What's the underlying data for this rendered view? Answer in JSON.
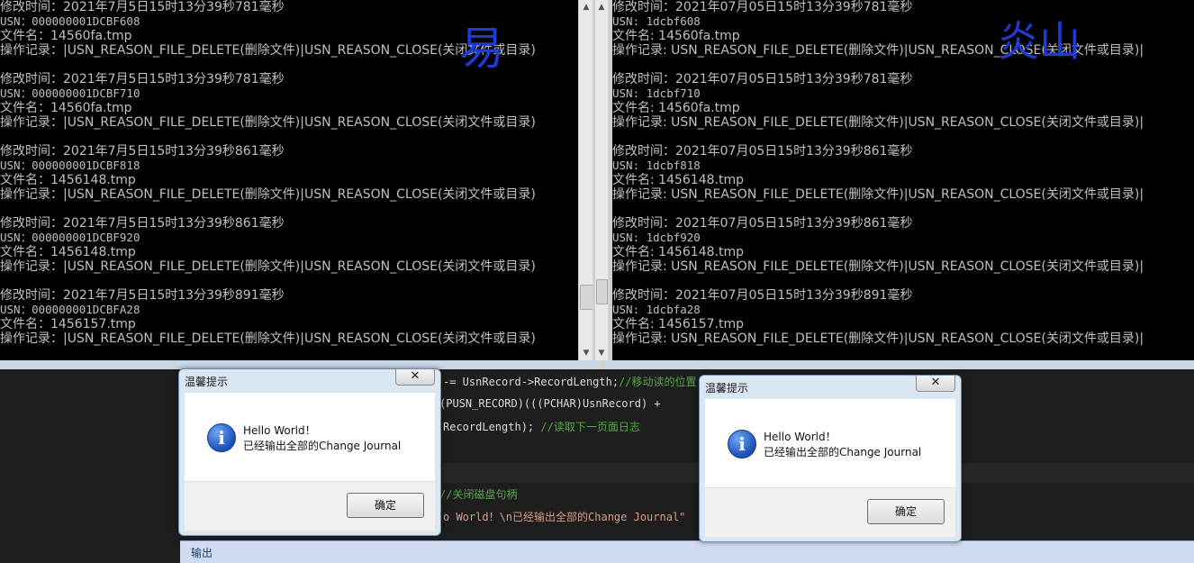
{
  "left_console": {
    "records": [
      {
        "time": "修改时间：2021年7月5日15时13分39秒781毫秒",
        "usn": "USN：000000001DCBF608",
        "name": "文件名：14560fa.tmp",
        "op": "操作记录：|USN_REASON_FILE_DELETE(删除文件)|USN_REASON_CLOSE(关闭文件或目录)"
      },
      {
        "time": "修改时间：2021年7月5日15时13分39秒781毫秒",
        "usn": "USN：000000001DCBF710",
        "name": "文件名：14560fa.tmp",
        "op": "操作记录：|USN_REASON_FILE_DELETE(删除文件)|USN_REASON_CLOSE(关闭文件或目录)"
      },
      {
        "time": "修改时间：2021年7月5日15时13分39秒861毫秒",
        "usn": "USN：000000001DCBF818",
        "name": "文件名：1456148.tmp",
        "op": "操作记录：|USN_REASON_FILE_DELETE(删除文件)|USN_REASON_CLOSE(关闭文件或目录)"
      },
      {
        "time": "修改时间：2021年7月5日15时13分39秒861毫秒",
        "usn": "USN：000000001DCBF920",
        "name": "文件名：1456148.tmp",
        "op": "操作记录：|USN_REASON_FILE_DELETE(删除文件)|USN_REASON_CLOSE(关闭文件或目录)"
      },
      {
        "time": "修改时间：2021年7月5日15时13分39秒891毫秒",
        "usn": "USN：000000001DCBFA28",
        "name": "文件名：1456157.tmp",
        "op": "操作记录：|USN_REASON_FILE_DELETE(删除文件)|USN_REASON_CLOSE(关闭文件或目录)"
      }
    ]
  },
  "right_console": {
    "records": [
      {
        "time": "修改时间：2021年07月05日15时13分39秒781毫秒",
        "usn": "USN: 1dcbf608",
        "name": "文件名: 14560fa.tmp",
        "op": "操作记录: USN_REASON_FILE_DELETE(删除文件)|USN_REASON_CLOSE(关闭文件或目录)|"
      },
      {
        "time": "修改时间：2021年07月05日15时13分39秒781毫秒",
        "usn": "USN: 1dcbf710",
        "name": "文件名: 14560fa.tmp",
        "op": "操作记录: USN_REASON_FILE_DELETE(删除文件)|USN_REASON_CLOSE(关闭文件或目录)|"
      },
      {
        "time": "修改时间：2021年07月05日15时13分39秒861毫秒",
        "usn": "USN: 1dcbf818",
        "name": "文件名: 1456148.tmp",
        "op": "操作记录: USN_REASON_FILE_DELETE(删除文件)|USN_REASON_CLOSE(关闭文件或目录)|"
      },
      {
        "time": "修改时间：2021年07月05日15时13分39秒861毫秒",
        "usn": "USN: 1dcbf920",
        "name": "文件名: 1456148.tmp",
        "op": "操作记录: USN_REASON_FILE_DELETE(删除文件)|USN_REASON_CLOSE(关闭文件或目录)|"
      },
      {
        "time": "修改时间：2021年07月05日15时13分39秒891毫秒",
        "usn": "USN: 1dcbfa28",
        "name": "文件名: 1456157.tmp",
        "op": "操作记录: USN_REASON_FILE_DELETE(删除文件)|USN_REASON_CLOSE(关闭文件或目录)|"
      }
    ]
  },
  "annotations": {
    "left": "易",
    "right": "炎山"
  },
  "code": {
    "line1_a": "-= UsnRecord->RecordLength;",
    "line1_b": "//移动读的位置",
    "line2": "(PUSN_RECORD)(((PCHAR)UsnRecord) +",
    "line3_a": "RecordLength); ",
    "line3_b": "//读取下一页面日志",
    "line4": "//关闭磁盘句柄",
    "line5": "o World！\\n已经输出全部的Change Journal\""
  },
  "output_bar": {
    "label": "输出"
  },
  "dialog_left": {
    "title": "温馨提示",
    "close": "✕",
    "line1": "Hello World！",
    "line2": "已经输出全部的Change Journal",
    "ok": "确定"
  },
  "dialog_right": {
    "title": "温馨提示",
    "close": "✕",
    "line1": "Hello World！",
    "line2": "已经输出全部的Change Journal",
    "ok": "确定"
  },
  "colors": {
    "console_bg": "#000000",
    "console_text": "#c0c0c0",
    "annotation": "#1f3bd6",
    "code_comment": "#57a64a",
    "code_string": "#d69d85"
  }
}
